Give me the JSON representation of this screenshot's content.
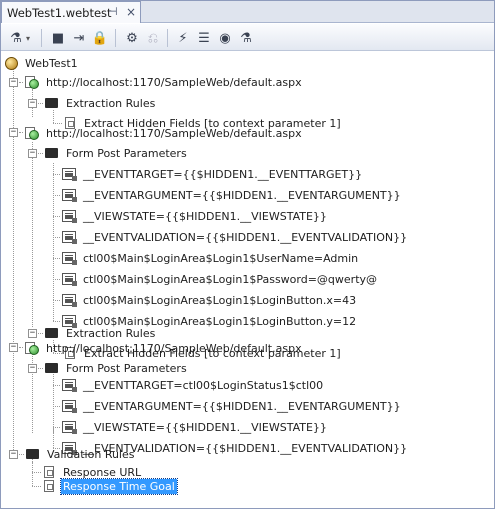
{
  "tab": {
    "title": "WebTest1.webtest",
    "pin_glyph": "⊣",
    "close_glyph": "×"
  },
  "toolbar": {
    "buttons": [
      {
        "icon": "add-request-icon",
        "glyph": "⚗"
      },
      {
        "icon": "dropdown-arrow-icon",
        "glyph": "▾"
      },
      {
        "icon": "stop-icon",
        "glyph": "■"
      },
      {
        "icon": "insert-request-icon",
        "glyph": "⇥"
      },
      {
        "icon": "lock-icon",
        "glyph": "🔒"
      },
      {
        "icon": "add-validation-rule-icon",
        "glyph": "⚙"
      },
      {
        "icon": "add-extraction-rule-icon",
        "glyph": "⎌"
      },
      {
        "icon": "parameterize-icon",
        "glyph": "⚡"
      },
      {
        "icon": "data-source-icon",
        "glyph": "☰"
      },
      {
        "icon": "record-icon",
        "glyph": "◉"
      },
      {
        "icon": "run-test-icon",
        "glyph": "⚗"
      }
    ]
  },
  "tree": {
    "root": "WebTest1",
    "request1": {
      "url": "http://localhost:1170/SampleWeb/default.aspx",
      "extraction_rules": "Extraction Rules",
      "rule": "Extract Hidden Fields [to context parameter 1]"
    },
    "request2": {
      "url": "http://localhost:1170/SampleWeb/default.aspx",
      "form_post": "Form Post Parameters",
      "params": [
        "__EVENTTARGET={{$HIDDEN1.__EVENTTARGET}}",
        "__EVENTARGUMENT={{$HIDDEN1.__EVENTARGUMENT}}",
        "__VIEWSTATE={{$HIDDEN1.__VIEWSTATE}}",
        "__EVENTVALIDATION={{$HIDDEN1.__EVENTVALIDATION}}",
        "ctl00$Main$LoginArea$Login1$UserName=Admin",
        "ctl00$Main$LoginArea$Login1$Password=@qwerty@",
        "ctl00$Main$LoginArea$Login1$LoginButton.x=43",
        "ctl00$Main$LoginArea$Login1$LoginButton.y=12"
      ],
      "extraction_rules": "Extraction Rules",
      "rule": "Extract Hidden Fields [to context parameter 1]"
    },
    "request3": {
      "url": "http://localhost:1170/SampleWeb/default.aspx",
      "form_post": "Form Post Parameters",
      "params": [
        "__EVENTTARGET=ctl00$LoginStatus1$ctl00",
        "__EVENTARGUMENT={{$HIDDEN1.__EVENTARGUMENT}}",
        "__VIEWSTATE={{$HIDDEN1.__VIEWSTATE}}",
        "__EVENTVALIDATION={{$HIDDEN1.__EVENTVALIDATION}}"
      ]
    },
    "validation": {
      "label": "Validation Rules",
      "rules": [
        "Response URL",
        "Response Time Goal"
      ]
    },
    "expand_minus": "−"
  }
}
